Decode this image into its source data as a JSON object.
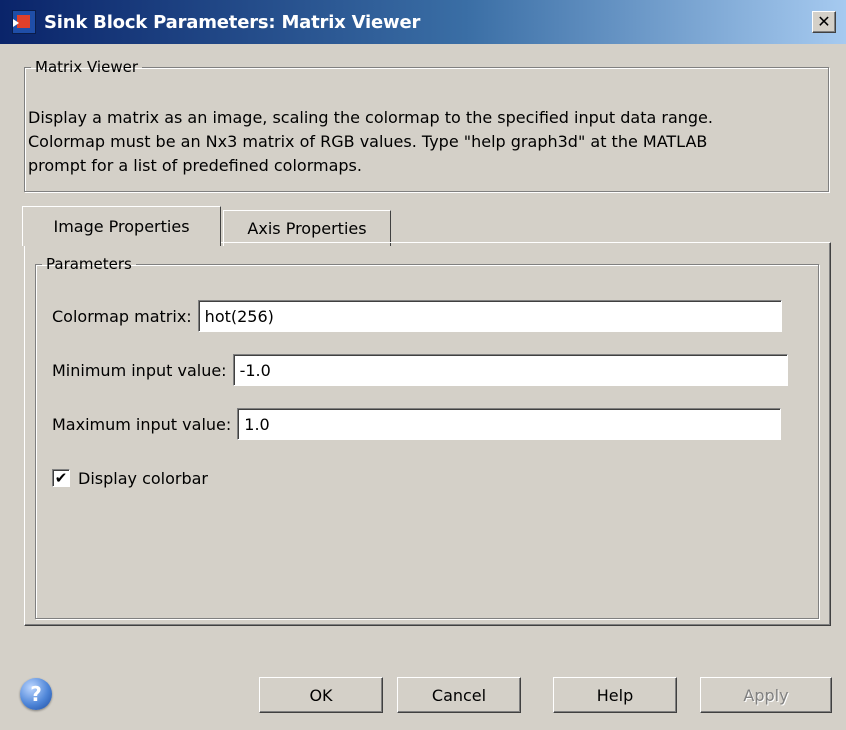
{
  "window": {
    "title": "Sink Block Parameters: Matrix Viewer",
    "close_glyph": "✕",
    "icon": "simulink-block-icon"
  },
  "description": {
    "group_title": "Matrix Viewer",
    "line1": "Display a matrix as an image, scaling the colormap to the specified input data range.",
    "line2": "Colormap must be an Nx3 matrix of RGB values.  Type \"help graph3d\" at the MATLAB",
    "line3": "prompt for a list of predefined colormaps."
  },
  "tabs": [
    {
      "label": "Image Properties",
      "selected": true
    },
    {
      "label": "Axis Properties",
      "selected": false
    }
  ],
  "parameters": {
    "group_title": "Parameters",
    "colormap": {
      "label": "Colormap matrix:",
      "value": "hot(256)"
    },
    "min_input": {
      "label": "Minimum input value:",
      "value": "-1.0"
    },
    "max_input": {
      "label": "Maximum input value:",
      "value": "1.0"
    },
    "colorbar": {
      "label": "Display colorbar",
      "checked": true,
      "mark": "✔"
    }
  },
  "buttons": {
    "ok": "OK",
    "cancel": "Cancel",
    "help": "Help",
    "apply": "Apply",
    "help_icon_glyph": "?"
  },
  "colors": {
    "title_gradient_start": "#0a246a",
    "title_gradient_end": "#a6caf0",
    "dialog_bg": "#d4d0c8"
  }
}
